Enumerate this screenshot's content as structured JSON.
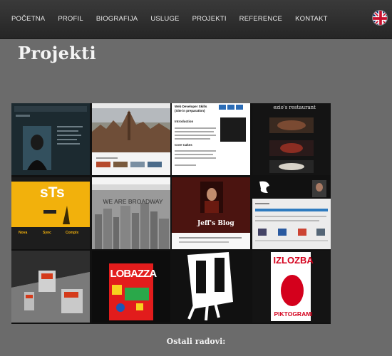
{
  "nav": {
    "items": [
      {
        "label": "POČETNA"
      },
      {
        "label": "PROFIL"
      },
      {
        "label": "BIOGRAFIJA"
      },
      {
        "label": "USLUGE"
      },
      {
        "label": "PROJEKTI"
      },
      {
        "label": "REFERENCE"
      },
      {
        "label": "KONTAKT"
      }
    ],
    "language_icon": "uk-flag-icon"
  },
  "page": {
    "title": "Projekti",
    "footer_heading": "Ostali radovi:"
  },
  "projects": {
    "sts": {
      "logo": "sTs",
      "col1": "Nova",
      "col2": "Sync",
      "col3": "Complx"
    },
    "broadway": {
      "heading": "WE ARE BROADWAY"
    },
    "jeff": {
      "heading": "Jeff's Blog"
    },
    "lobazza": {
      "heading": "LOBAZZA"
    },
    "izlozba": {
      "heading": "IZLOZBA",
      "footer": "PIKTOGRAMI"
    },
    "webdev": {
      "heading": "Web Developer Skills",
      "sub": "(Site in preparation)",
      "intro": "Introduction",
      "core": "Core Cakes"
    },
    "restaurant": {
      "heading": "ezio's restaurant"
    }
  },
  "colors": {
    "page_bg": "#6b6b6b",
    "nav_bg": "#2e2e2e",
    "sts_yellow": "#f2b10c",
    "lobazza_red": "#e21c1c",
    "izlozba_red": "#d4001c"
  }
}
